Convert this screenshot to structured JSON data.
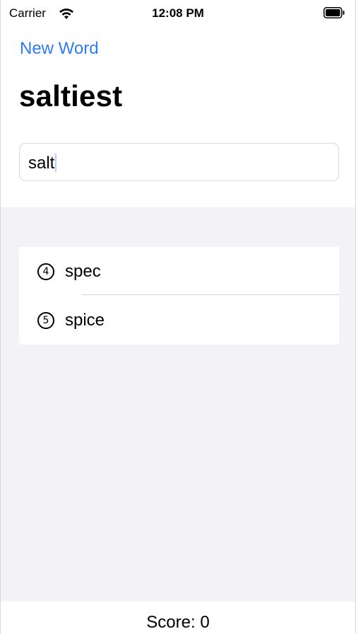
{
  "status_bar": {
    "carrier": "Carrier",
    "time": "12:08 PM",
    "wifi_icon": "wifi-icon",
    "battery_icon": "battery-full-icon"
  },
  "nav": {
    "left_button": "New Word",
    "title": "saltiest"
  },
  "input": {
    "value": "salt"
  },
  "words": [
    {
      "length_icon": "④",
      "word": "spec"
    },
    {
      "length_icon": "⑤",
      "word": "spice"
    }
  ],
  "footer": {
    "score": "Score: 0"
  },
  "colors": {
    "accent": "#2f7cf6",
    "grouped_background": "#f2f2f7"
  }
}
